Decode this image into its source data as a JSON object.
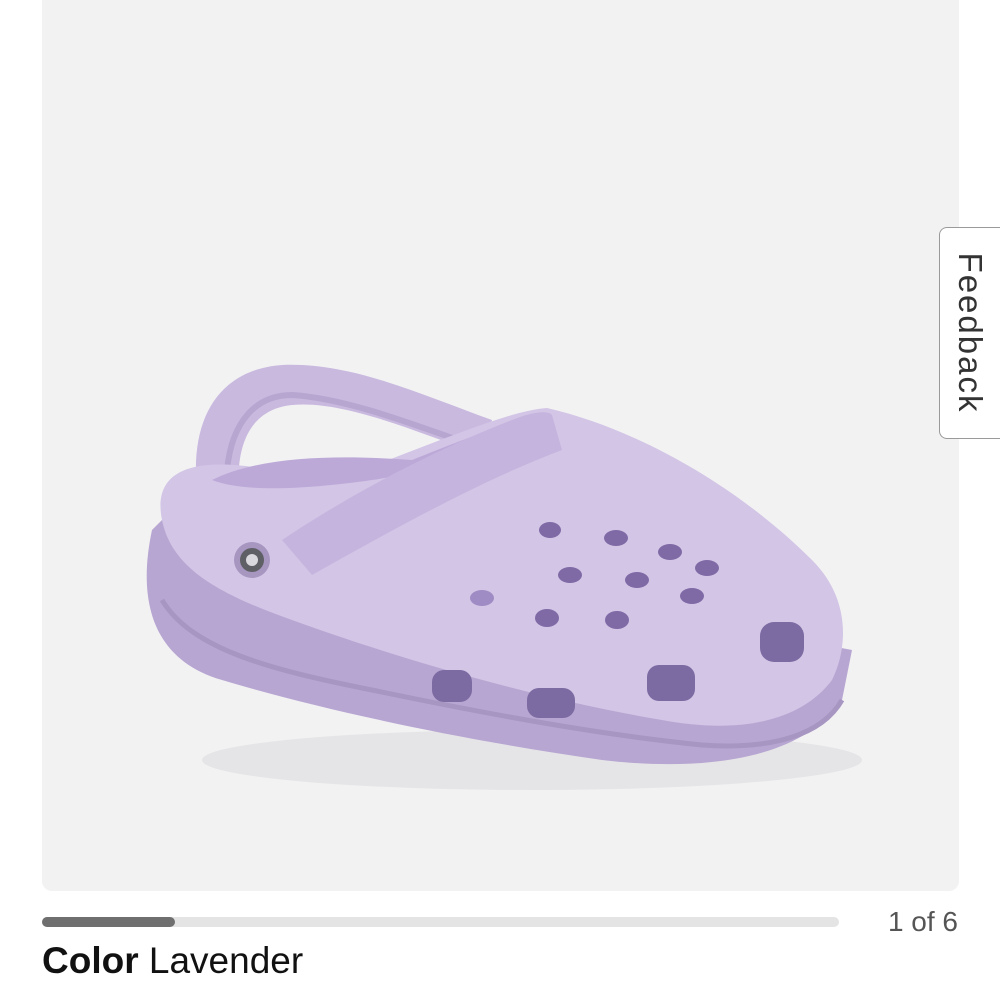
{
  "gallery": {
    "image_alt": "Lavender clog",
    "current_index": 1,
    "total": 6,
    "counter_text": "1 of 6",
    "progress_fraction": 0.1667
  },
  "feedback": {
    "label": "Feedback"
  },
  "product": {
    "color_label": "Color",
    "color_value": "Lavender"
  },
  "colors": {
    "background": "#f2f2f3",
    "clog": "#cbbbe0",
    "progress_fill": "#6f6f6f",
    "progress_track": "#e4e4e4"
  }
}
